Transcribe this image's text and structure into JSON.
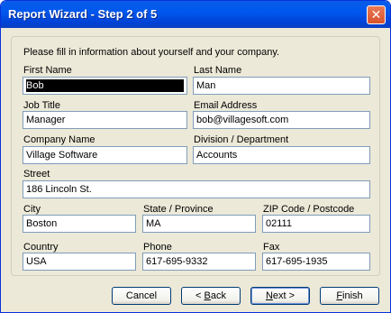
{
  "window": {
    "title": "Report Wizard - Step 2 of 5",
    "close_label": "✕"
  },
  "intro": "Please fill in information about yourself and your company.",
  "fields": {
    "first_name": {
      "label": "First Name",
      "value": "Bob"
    },
    "last_name": {
      "label": "Last Name",
      "value": "Man"
    },
    "job_title": {
      "label": "Job Title",
      "value": "Manager"
    },
    "email": {
      "label": "Email Address",
      "value": "bob@villagesoft.com"
    },
    "company": {
      "label": "Company Name",
      "value": "Village Software"
    },
    "division": {
      "label": "Division / Department",
      "value": "Accounts"
    },
    "street": {
      "label": "Street",
      "value": "186 Lincoln St."
    },
    "city": {
      "label": "City",
      "value": "Boston"
    },
    "state": {
      "label": "State / Province",
      "value": "MA"
    },
    "zip": {
      "label": "ZIP Code / Postcode",
      "value": "02111"
    },
    "country": {
      "label": "Country",
      "value": "USA"
    },
    "phone": {
      "label": "Phone",
      "value": "617-695-9332"
    },
    "fax": {
      "label": "Fax",
      "value": "617-695-1935"
    }
  },
  "buttons": {
    "cancel": "Cancel",
    "back_prefix": "< ",
    "back_key": "B",
    "back_rest": "ack",
    "next_key": "N",
    "next_rest": "ext >",
    "finish_key": "F",
    "finish_rest": "inish"
  }
}
